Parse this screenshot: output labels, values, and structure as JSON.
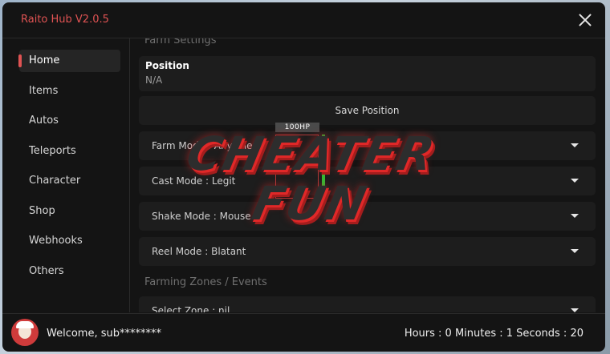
{
  "window": {
    "title": "Raito Hub V2.0.5"
  },
  "sidebar": {
    "items": [
      {
        "label": "Home",
        "active": true
      },
      {
        "label": "Items"
      },
      {
        "label": "Autos"
      },
      {
        "label": "Teleports"
      },
      {
        "label": "Character"
      },
      {
        "label": "Shop"
      },
      {
        "label": "Webhooks"
      },
      {
        "label": "Others"
      }
    ]
  },
  "main": {
    "section_farm": "Farm Settings",
    "position": {
      "title": "Position",
      "value": "N/A"
    },
    "save_position_label": "Save Position",
    "dropdowns": [
      {
        "label": "Farm Mode : Anywhere"
      },
      {
        "label": "Cast Mode : Legit"
      },
      {
        "label": "Shake Mode : Mouse"
      },
      {
        "label": "Reel Mode : Blatant"
      }
    ],
    "section_zones": "Farming Zones / Events",
    "zone_dropdown": {
      "label": "Select Zone : nil"
    }
  },
  "footer": {
    "welcome": "Welcome, sub********",
    "timer": "Hours : 0 Minutes : 1 Seconds : 20"
  },
  "overlay": {
    "hp_label": "100HP",
    "watermark_line1": "CHEATER",
    "watermark_line2": "FUN"
  },
  "colors": {
    "accent": "#e05353",
    "background": "#141414",
    "card": "#1d1d1d",
    "hp": "#33bb33"
  },
  "icons": {
    "close": "close-icon",
    "dropdown": "triangle-down-icon",
    "avatar": "avatar-icon"
  }
}
